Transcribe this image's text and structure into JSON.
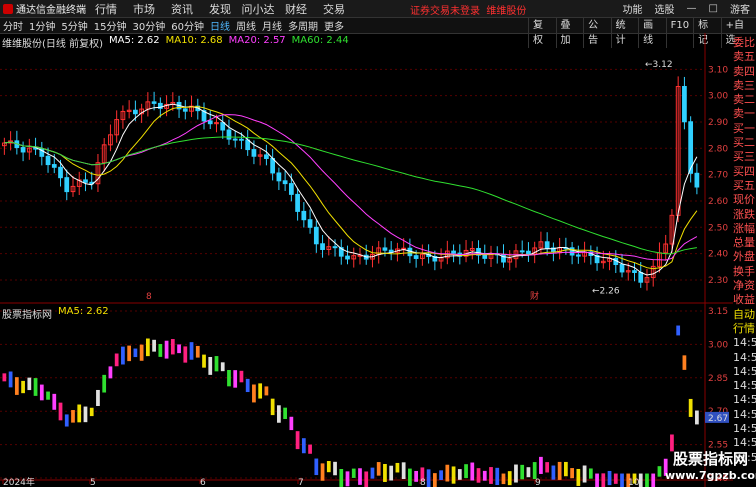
{
  "app": {
    "title": "通达信金融终端"
  },
  "menu": [
    "行情",
    "市场",
    "资讯",
    "发现",
    "问小达",
    "财经",
    "交易"
  ],
  "promo": "证券交易未登录",
  "stock_name": "维维股份",
  "top_right": [
    "功能",
    "选股",
    "游客"
  ],
  "periods": [
    "分时",
    "1分钟",
    "5分钟",
    "15分钟",
    "30分钟",
    "60分钟",
    "日线",
    "周线",
    "月线",
    "多周期",
    "更多"
  ],
  "active_period": "日线",
  "right_tools": [
    "复权",
    "叠加",
    "公告",
    "统计",
    "画线",
    "F10",
    "标记",
    "+自选"
  ],
  "main_panel": {
    "label": "维维股份(日线 前复权)",
    "ma": [
      {
        "text": "MA5: 2.62",
        "color": "#ffffff"
      },
      {
        "text": "MA10: 2.68",
        "color": "#f0e000"
      },
      {
        "text": "MA20: 2.57",
        "color": "#ff40ff"
      },
      {
        "text": "MA60: 2.44",
        "color": "#30e030"
      }
    ],
    "y_ticks": [
      "3.10",
      "3.00",
      "2.90",
      "2.80",
      "2.70",
      "2.60",
      "2.50",
      "2.40",
      "2.30"
    ],
    "y_range": [
      2.22,
      3.2
    ],
    "high_label": "3.12",
    "low_label": "2.26",
    "markers": [
      "8",
      "财"
    ]
  },
  "sub_panel": {
    "label": "股票指标网",
    "ma": "MA5: 2.62",
    "y_ticks": [
      "3.15",
      "3.00",
      "2.85",
      "2.70",
      "2.55",
      "2.40"
    ],
    "current_value": "2.67"
  },
  "x_axis": [
    "2024年",
    "5",
    "6",
    "7",
    "8",
    "9",
    "10"
  ],
  "side_panel": [
    "委比",
    "卖五",
    "卖四",
    "卖三",
    "卖二",
    "卖一",
    "买一",
    "买二",
    "买三",
    "买四",
    "买五",
    "现价",
    "涨跌",
    "涨幅",
    "总量",
    "外盘",
    "换手",
    "净资",
    "收益"
  ],
  "side_panel_bottom": [
    "自动",
    "行情",
    "14:50",
    "14:50",
    "14:50",
    "14:50",
    "14:50",
    "14:50",
    "14:50",
    "14:50",
    "14:50"
  ],
  "watermark": {
    "line1": "股票指标网",
    "line2": "www.7gpzb.com"
  },
  "colors": {
    "up": "#ff3030",
    "down": "#30d0ff",
    "ma5": "#ffffff",
    "ma10": "#f0e000",
    "ma20": "#ff40ff",
    "ma60": "#30e030"
  }
}
